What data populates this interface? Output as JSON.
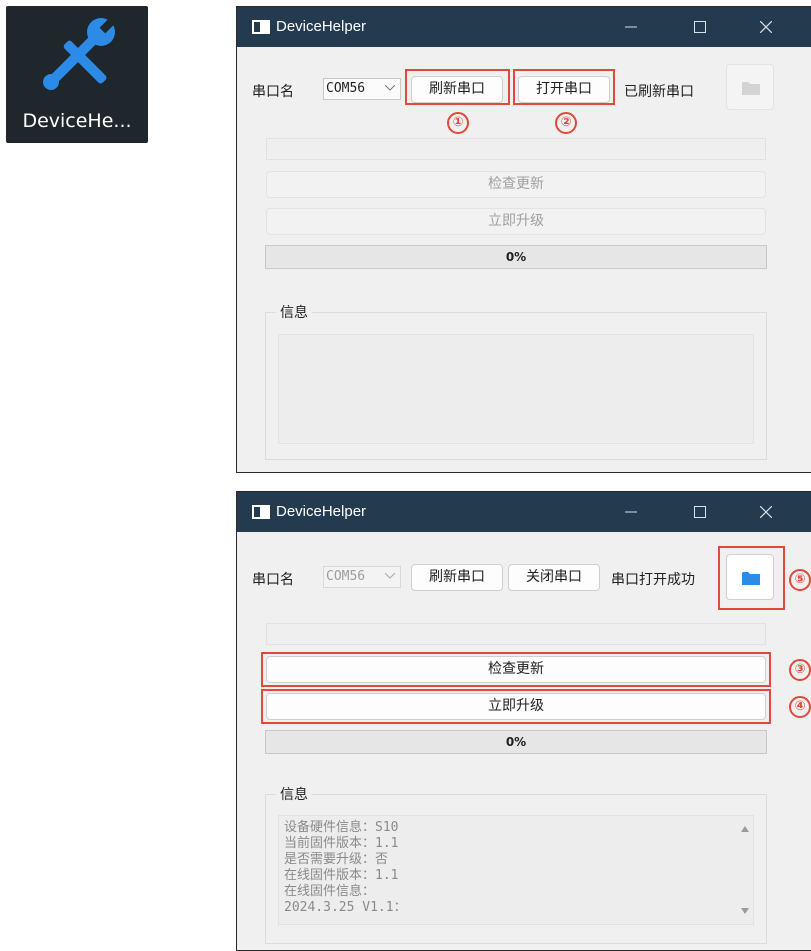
{
  "desktop_icon": {
    "label": "DeviceHe...",
    "icon": "wrench-screwdriver-icon",
    "color": "#2b8be6"
  },
  "windows": [
    {
      "title": "DeviceHelper",
      "port_label": "串口名",
      "port_value": "COM56",
      "refresh_button": "刷新串口",
      "toggle_button": "打开串口",
      "status": "已刷新串口",
      "check_update_button": "检查更新",
      "upgrade_button": "立即升级",
      "progress": "0%",
      "info_label": "信息",
      "info_text": ""
    },
    {
      "title": "DeviceHelper",
      "port_label": "串口名",
      "port_value": "COM56",
      "refresh_button": "刷新串口",
      "toggle_button": "关闭串口",
      "status": "串口打开成功",
      "check_update_button": "检查更新",
      "upgrade_button": "立即升级",
      "progress": "0%",
      "info_label": "信息",
      "info_text": "设备硬件信息：S10\n当前固件版本：1.1\n是否需要升级：否\n在线固件版本：1.1\n在线固件信息：\n2024.3.25 V1.1："
    }
  ],
  "callouts": [
    "①",
    "②",
    "③",
    "④",
    "⑤"
  ],
  "colors": {
    "titlebar": "#243a4f",
    "callout": "#e04a3a",
    "folder": "#2b8be6"
  }
}
